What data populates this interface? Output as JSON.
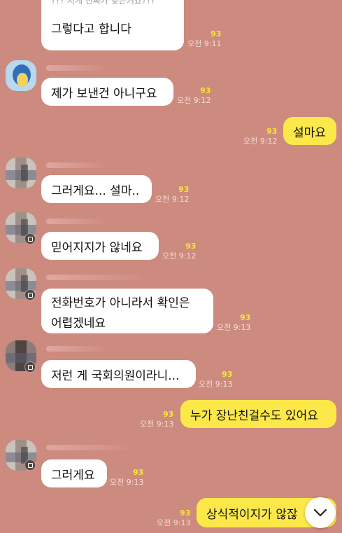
{
  "chat": {
    "messages": [
      {
        "id": "m0",
        "side": "left",
        "text": "??? 저게 진짜가 맞는거죠???",
        "text2": "그렇다고 합니다",
        "count": "93",
        "time": "오전 9:11"
      },
      {
        "id": "m1",
        "side": "left",
        "sender": "",
        "text": "제가 보낸건 아니구요",
        "count": "93",
        "time": "오전 9:12"
      },
      {
        "id": "m2",
        "side": "right",
        "text": "설마요",
        "count": "93",
        "time": "오전 9:12"
      },
      {
        "id": "m3",
        "side": "left",
        "sender": "",
        "text": "그러게요... 설마..",
        "count": "93",
        "time": "오전 9:12"
      },
      {
        "id": "m4",
        "side": "left",
        "sender": "",
        "text": "믿어지지가 않네요",
        "count": "93",
        "time": "오전 9:12"
      },
      {
        "id": "m5",
        "side": "left",
        "sender": "",
        "text": "전화번호가 아니라서 확인은\n어렵겠네요",
        "count": "93",
        "time": "오전 9:13"
      },
      {
        "id": "m6",
        "side": "left",
        "sender": "",
        "text": "저런 게 국회의원이라니...",
        "count": "93",
        "time": "오전 9:13"
      },
      {
        "id": "m7",
        "side": "right",
        "text": "누가 장난친걸수도 있어요",
        "count": "93",
        "time": "오전 9:13"
      },
      {
        "id": "m8",
        "side": "left",
        "sender": "",
        "text": "그러게요",
        "count": "93",
        "time": "오전 9:13"
      },
      {
        "id": "m9",
        "side": "right",
        "text": "상식적이지가 않잖",
        "count": "93",
        "time": "오전 9:13"
      }
    ]
  },
  "colors": {
    "background": "#cd8a7e",
    "incoming_bubble": "#ffffff",
    "outgoing_bubble": "#fde84a",
    "unread_count": "#f5e637"
  },
  "icons": {
    "scroll_down": "chevron-down-icon",
    "avatar_badge": "chat-badge-icon"
  }
}
